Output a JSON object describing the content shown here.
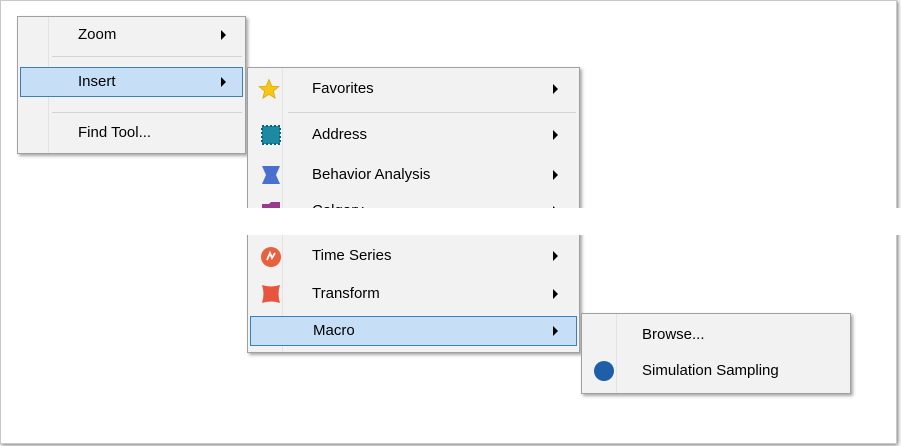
{
  "menu_main": {
    "items": [
      {
        "label": "Zoom",
        "has_submenu": true
      },
      {
        "label": "Insert",
        "has_submenu": true,
        "selected": true
      },
      {
        "label": "Find Tool...",
        "has_submenu": false
      }
    ]
  },
  "menu_insert": {
    "items": [
      {
        "label": "Favorites",
        "icon": "star-icon",
        "icon_color": "#f5c518"
      },
      {
        "label": "Address",
        "icon": "address-icon",
        "icon_color": "#1d8aa3"
      },
      {
        "label": "Behavior Analysis",
        "icon": "behavior-analysis-icon",
        "icon_color": "#4a6fcf"
      },
      {
        "label": "Calgary",
        "icon": "calgary-icon",
        "icon_color": "#9a3a8c"
      },
      {
        "label": "Time Series",
        "icon": "time-series-icon",
        "icon_color": "#e8603e"
      },
      {
        "label": "Transform",
        "icon": "transform-icon",
        "icon_color": "#e8543e"
      },
      {
        "label": "Macro",
        "icon": "",
        "selected": true
      }
    ]
  },
  "menu_macro": {
    "items": [
      {
        "label": "Browse...",
        "icon": ""
      },
      {
        "label": "Simulation Sampling",
        "icon": "circle-icon",
        "icon_color": "#1f5fa8"
      }
    ]
  },
  "colors": {
    "selection_fill": "#c6def6",
    "selection_border": "#3c7fb1",
    "menu_background": "#f2f2f2"
  }
}
